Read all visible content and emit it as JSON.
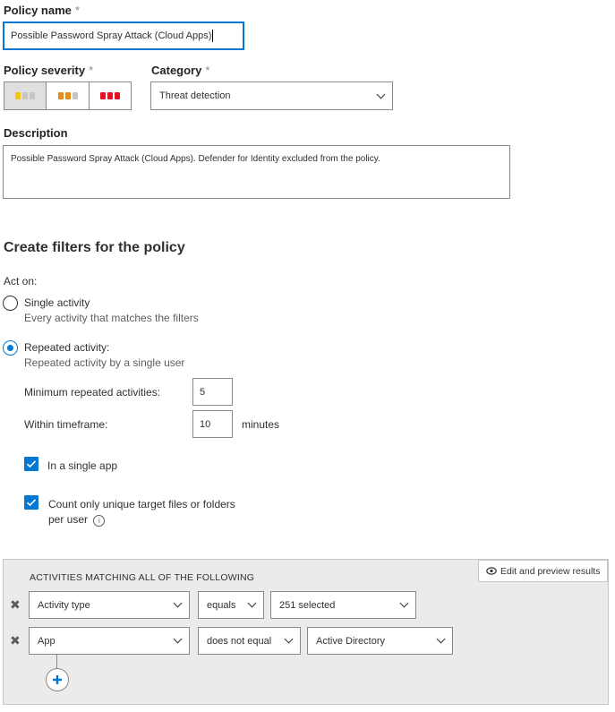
{
  "policy_name": {
    "label": "Policy name",
    "required": "*",
    "value": "Possible Password Spray Attack (Cloud Apps)"
  },
  "severity": {
    "label": "Policy severity",
    "required": "*",
    "options": [
      {
        "name": "low",
        "color": "#f2c811",
        "selected": true
      },
      {
        "name": "medium",
        "color": "#ea8c14"
      },
      {
        "name": "high",
        "color": "#e81123"
      }
    ],
    "inactive_color": "#c8c6c4"
  },
  "category": {
    "label": "Category",
    "required": "*",
    "value": "Threat detection"
  },
  "description": {
    "label": "Description",
    "value": "Possible Password Spray Attack (Cloud Apps). Defender for Identity excluded from the policy."
  },
  "filters": {
    "heading": "Create filters for the policy",
    "act_on_label": "Act on:",
    "single": {
      "label": "Single activity",
      "sub": "Every activity that matches the filters",
      "selected": false
    },
    "repeated": {
      "label": "Repeated activity:",
      "sub": "Repeated activity by a single user",
      "selected": true
    },
    "min_label": "Minimum repeated activities:",
    "min_value": "5",
    "timeframe_label": "Within timeframe:",
    "timeframe_value": "10",
    "timeframe_unit": "minutes",
    "single_app_label": "In a single app",
    "unique_label_line1": "Count only unique target files or folders",
    "unique_label_line2": "per user"
  },
  "activities": {
    "heading": "ACTIVITIES MATCHING ALL OF THE FOLLOWING",
    "edit_preview": "Edit and preview results",
    "rows": [
      {
        "field": "Activity type",
        "operator": "equals",
        "value": "251 selected"
      },
      {
        "field": "App",
        "operator": "does not equal",
        "value": "Active Directory"
      }
    ]
  },
  "accent": "#0078d4"
}
